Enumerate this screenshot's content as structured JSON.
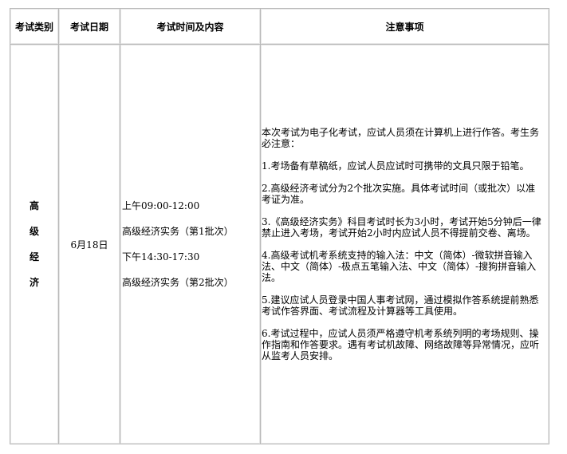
{
  "headers": [
    "考试类别",
    "考试日期",
    "考试时间及内容",
    "注意事项"
  ],
  "category_chars": [
    "高",
    "级",
    "经",
    "济"
  ],
  "date": "6月18日",
  "schedule": {
    "morning_time": "上午09:00-12:00",
    "morning_subject": "高级经济实务（第1批次）",
    "afternoon_time": "下午14:30-17:30",
    "afternoon_subject": "高级经济实务（第2批次）"
  },
  "notes": [
    "本次考试为电子化考试，应试人员须在计算机上进行作答。考生务必注意：",
    "1.考场备有草稿纸，应试人员应试时可携带的文具只限于铅笔。",
    "2.高级经济考试分为2个批次实施。具体考试时间（或批次）以准考证为准。",
    "3.《高级经济实务》科目考试时长为3小时，考试开始5分钟后一律禁止进入考场，考试开始2小时内应试人员不得提前交卷、离场。",
    "4.高级考试机考系统支持的输入法：中文（简体）-微软拼音输入法、中文（简体）-极点五笔输入法、中文（简体）-搜狗拼音输入法。",
    "5.建议应试人员登录中国人事考试网，通过模拟作答系统提前熟悉考试作答界面、考试流程及计算器等工具使用。",
    "6.考试过程中，应试人员须严格遵守机考系统列明的考场规则、操作指南和作答要求。遇有考试机故障、网络故障等异常情况，应听从监考人员安排。"
  ]
}
